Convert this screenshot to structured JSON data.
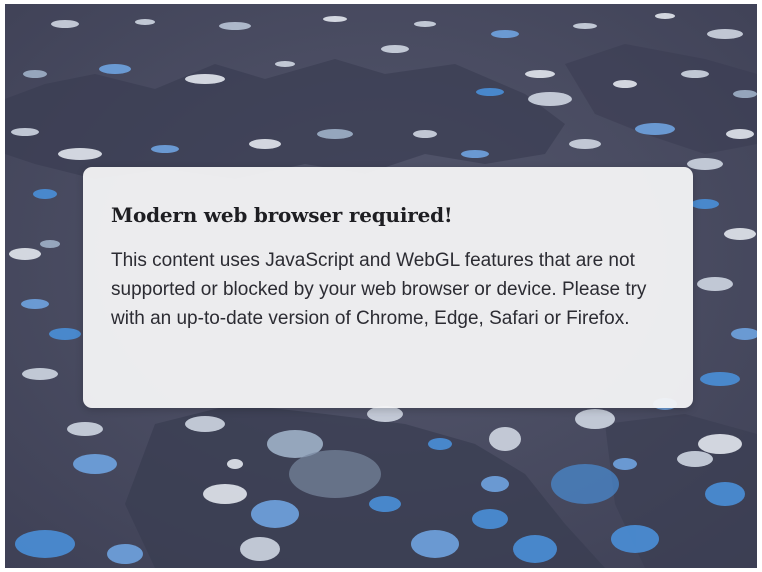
{
  "dialog": {
    "title": "Modern web browser required!",
    "message": "This content uses JavaScript and WebGL features that are not supported or blocked by your web browser or device. Please try with an up-to-date version of Chrome, Edge, Safari or Firefox."
  },
  "colors": {
    "background": "#4a4d62",
    "landmass": "#3c3f55",
    "dialog_bg": "#f4f4f6",
    "title_text": "#1e1e22",
    "body_text": "#2c2c33",
    "dot_light": "#d8dde6",
    "dot_blue": "#4a8fd8"
  }
}
